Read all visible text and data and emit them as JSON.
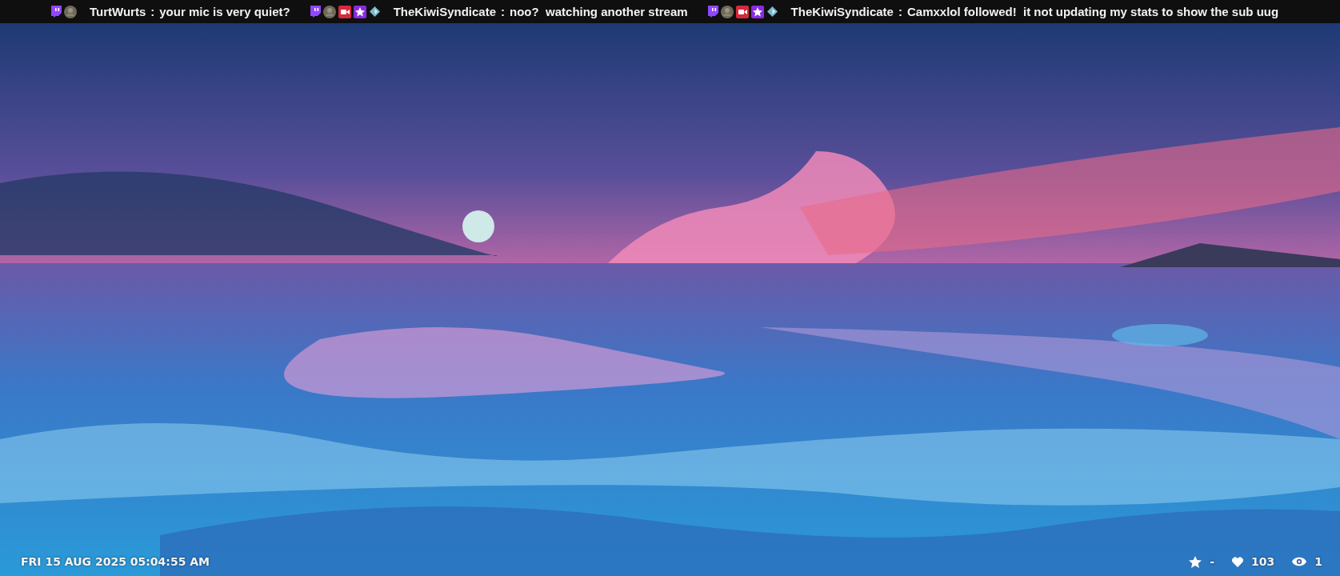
{
  "chat_ticker": {
    "messages": [
      {
        "badges": [
          {
            "kind": "twitch"
          },
          {
            "kind": "avatar"
          }
        ],
        "user": "TurtWurts",
        "separator": ":",
        "text": "your mic is very quiet?"
      },
      {
        "badges": [
          {
            "kind": "twitch"
          },
          {
            "kind": "avatar"
          },
          {
            "kind": "camera"
          },
          {
            "kind": "star"
          },
          {
            "kind": "diamond"
          }
        ],
        "user": "TheKiwiSyndicate",
        "separator": ":",
        "text": "noo?  watching another stream"
      },
      {
        "badges": [
          {
            "kind": "twitch"
          },
          {
            "kind": "avatar"
          },
          {
            "kind": "camera"
          },
          {
            "kind": "star"
          },
          {
            "kind": "diamond"
          }
        ],
        "user": "TheKiwiSyndicate",
        "separator": ":",
        "text": "Camxxlol followed!  it not updating my stats to show the sub uug"
      }
    ]
  },
  "footer": {
    "clock": "FRI 15 AUG 2025 05:04:55 AM",
    "stats": [
      {
        "kind": "star",
        "value": "-"
      },
      {
        "kind": "heart",
        "value": "103"
      },
      {
        "kind": "eye",
        "value": "1"
      }
    ]
  }
}
